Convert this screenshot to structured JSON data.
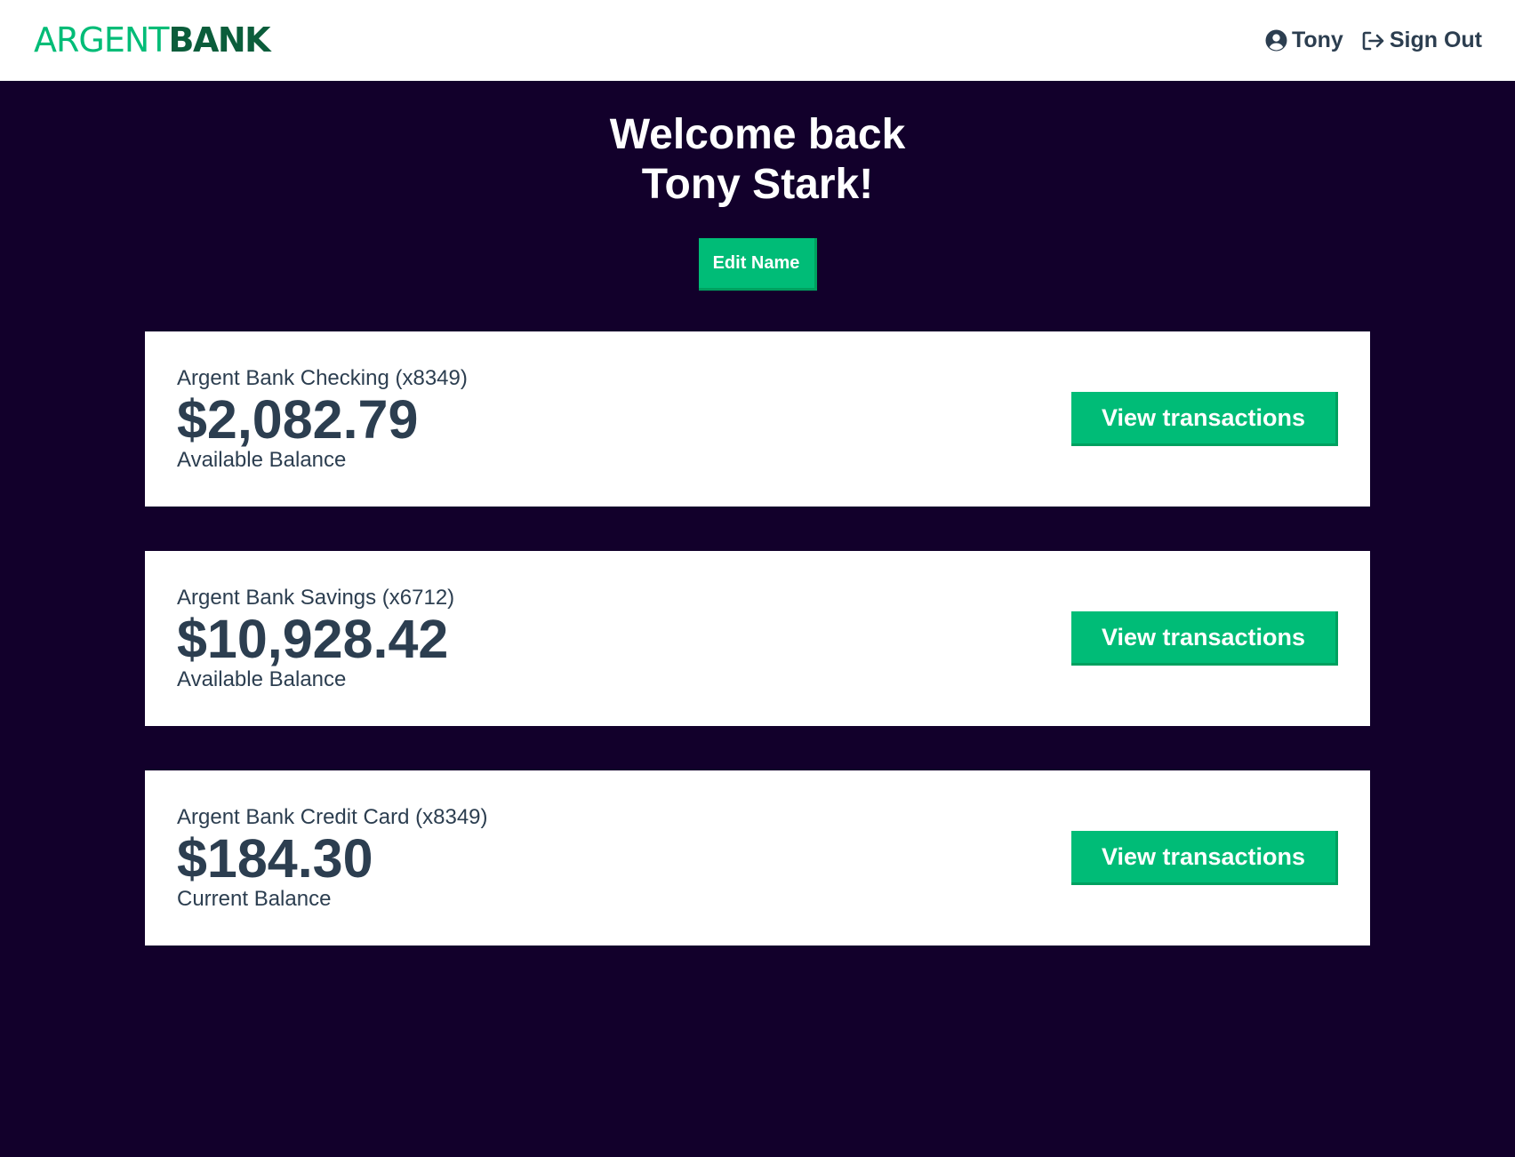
{
  "nav": {
    "logo_part1": "ARGENT",
    "logo_part2": "BANK",
    "user_name": "Tony",
    "sign_out_label": "Sign Out"
  },
  "header": {
    "line1": "Welcome back",
    "line2": "Tony Stark!",
    "edit_name_label": "Edit Name"
  },
  "accounts": [
    {
      "title": "Argent Bank Checking (x8349)",
      "amount": "$2,082.79",
      "description": "Available Balance",
      "button_label": "View transactions"
    },
    {
      "title": "Argent Bank Savings (x6712)",
      "amount": "$10,928.42",
      "description": "Available Balance",
      "button_label": "View transactions"
    },
    {
      "title": "Argent Bank Credit Card (x8349)",
      "amount": "$184.30",
      "description": "Current Balance",
      "button_label": "View transactions"
    }
  ],
  "icons": {
    "user": "user-circle-icon",
    "sign_out": "sign-out-icon"
  },
  "colors": {
    "accent": "#00bc77",
    "accent_dark": "#0b5d3b",
    "background": "#12002b",
    "text": "#2c3e50"
  }
}
